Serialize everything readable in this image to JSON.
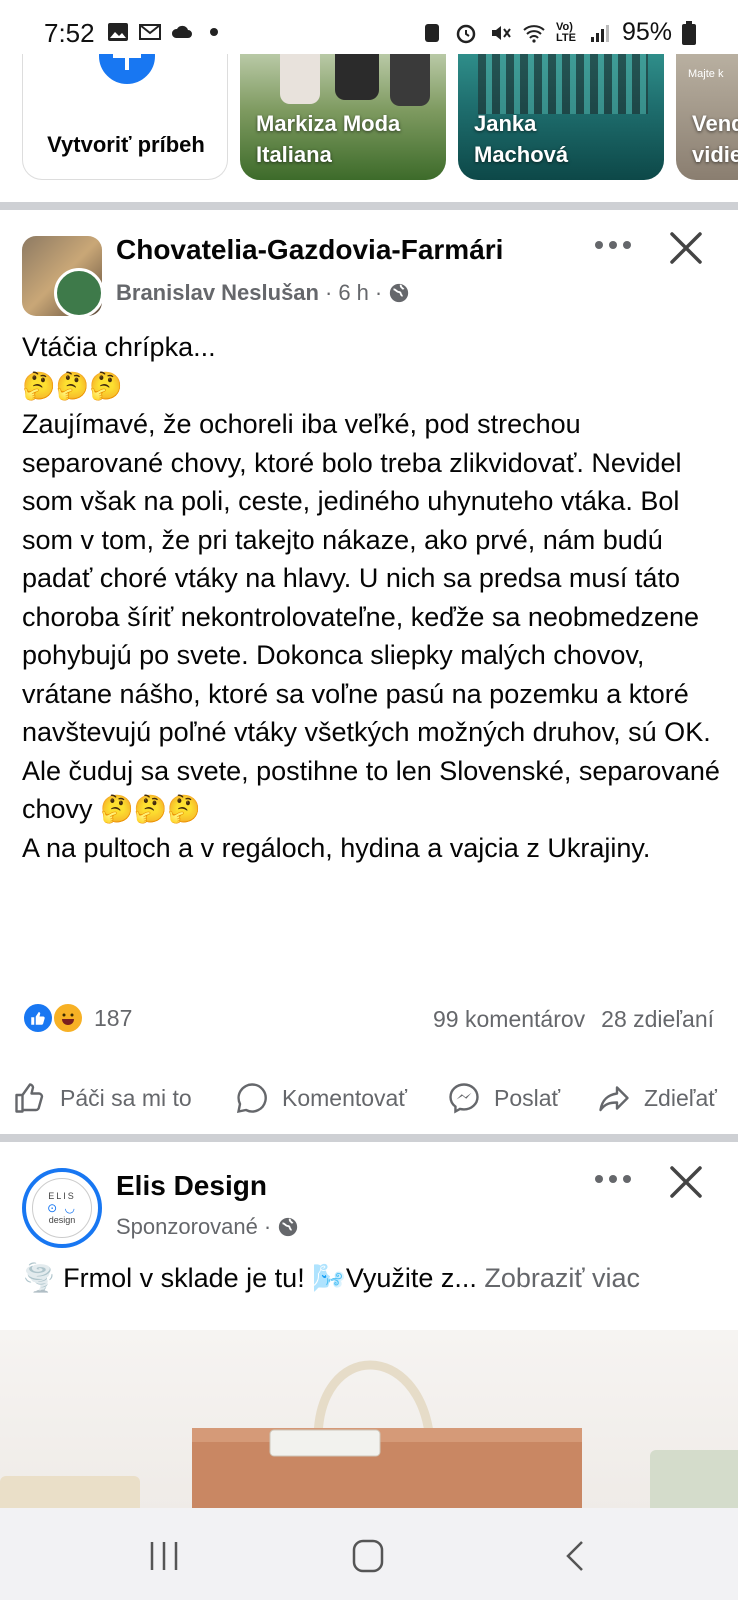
{
  "status_bar": {
    "time": "7:52",
    "battery": "95%",
    "volte": "Vo) LTE"
  },
  "stories": {
    "create_label": "Vytvoriť príbeh",
    "items": [
      {
        "label_line1": "Markiza Moda",
        "label_line2": "Italiana"
      },
      {
        "label_line1": "Janka",
        "label_line2": "Machová"
      },
      {
        "label_line1": "Vend",
        "label_line2": "vidie",
        "badge": "Majte k"
      }
    ]
  },
  "post": {
    "group_name": "Chovatelia-Gazdovia-Farmári",
    "author": "Branislav Neslušan",
    "separator": "·",
    "time": "6 h",
    "text": "Vtáčia chrípka...\n🤔🤔🤔\nZaujímavé, že ochoreli iba veľké, pod strechou separované chovy, ktoré bolo treba zlikvidovať. Nevidel som však na poli, ceste, jediného uhynuteho vtáka. Bol som v tom, že pri takejto nákaze, ako prvé, nám budú padať choré vtáky na hlavy. U nich sa predsa musí táto choroba šíriť nekontrolovateľne, keďže sa neobmedzene pohybujú po svete. Dokonca sliepky malých chovov, vrátane nášho, ktoré sa voľne pasú na pozemku a ktoré navštevujú poľné vtáky všetkých možných druhov, sú OK.\nAle čuduj sa svete, postihne to len Slovenské, separované chovy 🤔🤔🤔\nA na pultoch a v regáloch, hydina a vajcia z Ukrajiny.",
    "reaction_count": "187",
    "comments": "99 komentárov",
    "shares": "28 zdieľaní",
    "actions": {
      "like": "Páči sa mi to",
      "comment": "Komentovať",
      "send": "Poslať",
      "share": "Zdieľať"
    }
  },
  "sponsored": {
    "page_name": "Elis Design",
    "label": "Sponzorované",
    "separator": "·",
    "logo_text_top": "ELIS",
    "logo_text_bottom": "design",
    "text_prefix": "🌪️ Frmol v sklade je tu! 🌬️Využite z... ",
    "see_more": "Zobraziť viac"
  },
  "colors": {
    "accent": "#1877f2",
    "secondary_text": "#65676b",
    "divider": "#ced0d4"
  }
}
